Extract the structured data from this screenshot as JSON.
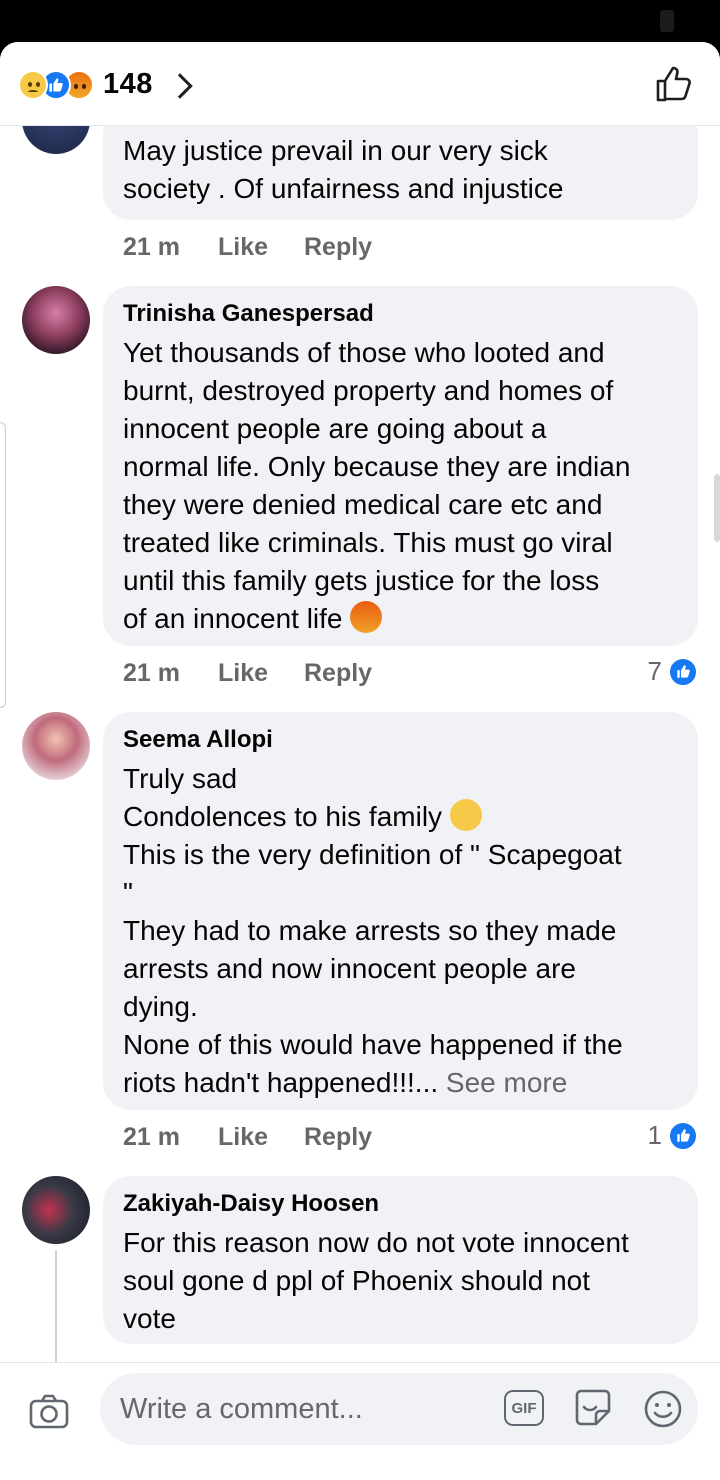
{
  "header": {
    "reaction_icons": [
      "sad-icon",
      "like-icon",
      "angry-icon"
    ],
    "reaction_count": "148"
  },
  "comments": [
    {
      "author": "",
      "text": "May justice prevail in our very sick\nsociety . Of unfairness and injustice",
      "time": "21 m",
      "like_label": "Like",
      "reply_label": "Reply",
      "likes": ""
    },
    {
      "author": "Trinisha Ganespersad",
      "text": "Yet thousands of those who looted and\nburnt, destroyed property and homes of\ninnocent people are going about a\nnormal life. Only because they are indian\nthey were denied medical care etc and\ntreated like criminals. This must go viral\nuntil this family gets justice for the loss\nof an innocent life ",
      "emoji": "angry-face-icon",
      "time": "21 m",
      "like_label": "Like",
      "reply_label": "Reply",
      "likes": "7"
    },
    {
      "author": "Seema Allopi",
      "text": "Truly sad\nCondolences to his family ",
      "text2": "\nThis is the very definition of \" Scapegoat\n\"\nThey had to make arrests so they made\narrests and now innocent people are\ndying.\nNone of this would have happened if the\nriots hadn't happened!!!... ",
      "see_more": "See more",
      "emoji": "pleading-face-icon",
      "time": "21 m",
      "like_label": "Like",
      "reply_label": "Reply",
      "likes": "1"
    },
    {
      "author": "Zakiyah-Daisy Hoosen",
      "text": "For this reason now do not vote innocent\nsoul gone d ppl of Phoenix should not\nvote"
    }
  ],
  "composer": {
    "placeholder": "Write a comment...",
    "gif_label": "GIF"
  },
  "colors": {
    "accent": "#1877f2",
    "bubble": "#f0f2f5",
    "meta": "#65676b"
  }
}
